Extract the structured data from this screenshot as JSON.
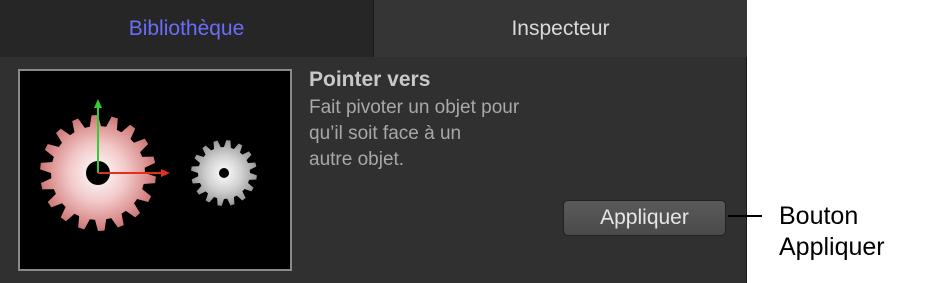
{
  "tabs": {
    "library": "Bibliothèque",
    "inspector": "Inspecteur"
  },
  "behavior": {
    "title": "Pointer vers",
    "description_lines": [
      "Fait pivoter un objet pour",
      "qu’il soit face à un",
      "autre objet."
    ]
  },
  "apply_button": "Appliquer",
  "callout": {
    "lines": [
      "Bouton",
      "Appliquer"
    ]
  },
  "colors": {
    "active_tab": "#6b6dfa",
    "panel_bg": "#303030",
    "y_axis_arrow": "#33cc33",
    "x_axis_arrow": "#e0301e"
  },
  "icons": {
    "large_gear": "gear-icon",
    "small_gear": "gear-icon"
  }
}
